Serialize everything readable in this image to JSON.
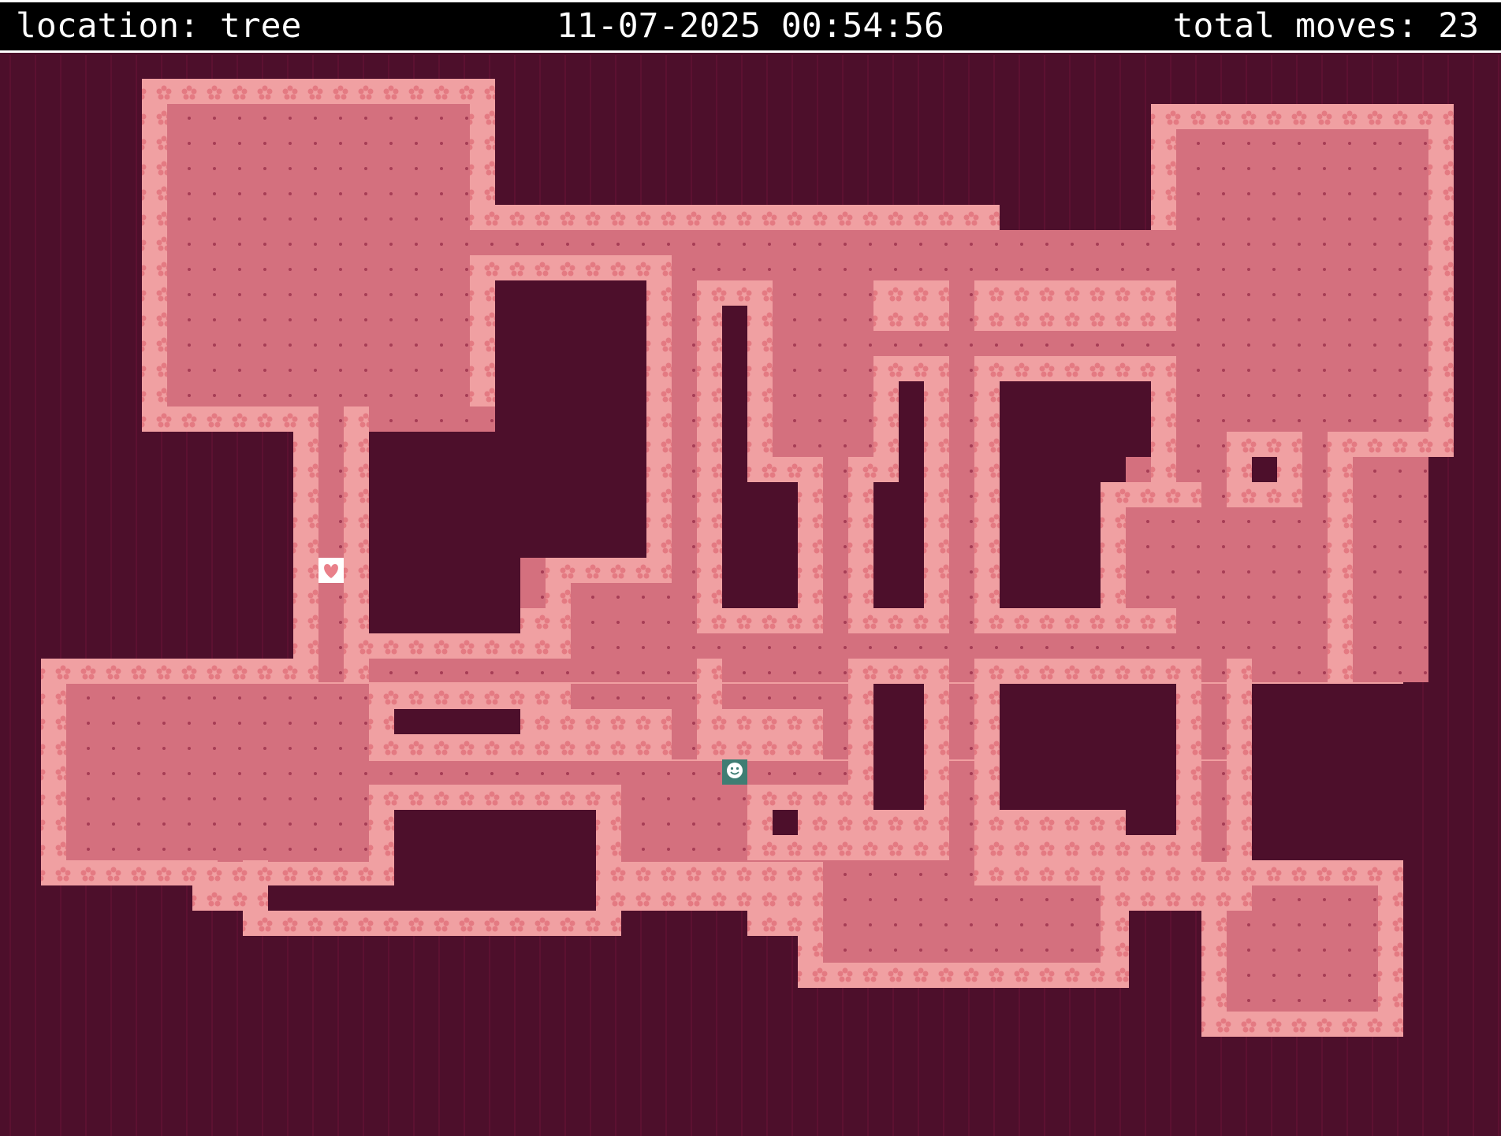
{
  "status": {
    "location": "location: tree",
    "datetime": "11-07-2025 00:54:56",
    "moves": "total moves: 23"
  },
  "colors": {
    "void": "#4d0f2b",
    "floor": "#d4707e",
    "wall": "#f0a0a2",
    "player": "#3f7d73",
    "heart": "#ffffff"
  },
  "entities": {
    "player": "player-smiley-icon",
    "heart": "heart-icon"
  }
}
